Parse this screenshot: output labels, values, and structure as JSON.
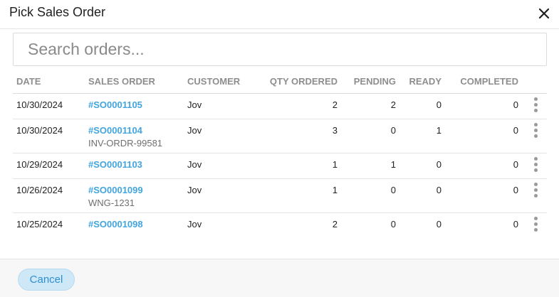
{
  "dialog": {
    "title": "Pick Sales Order"
  },
  "search": {
    "placeholder": "Search orders...",
    "value": ""
  },
  "table": {
    "columns": [
      "DATE",
      "SALES ORDER",
      "CUSTOMER",
      "QTY ORDERED",
      "PENDING",
      "READY",
      "COMPLETED"
    ],
    "rows": [
      {
        "date": "10/30/2024",
        "order": "#SO0001105",
        "ref": "",
        "customer": "Jov",
        "qty_ordered": "2",
        "pending": "2",
        "ready": "0",
        "completed": "0"
      },
      {
        "date": "10/30/2024",
        "order": "#SO0001104",
        "ref": "INV-ORDR-99581",
        "customer": "Jov",
        "qty_ordered": "3",
        "pending": "0",
        "ready": "1",
        "completed": "0"
      },
      {
        "date": "10/29/2024",
        "order": "#SO0001103",
        "ref": "",
        "customer": "Jov",
        "qty_ordered": "1",
        "pending": "1",
        "ready": "0",
        "completed": "0"
      },
      {
        "date": "10/26/2024",
        "order": "#SO0001099",
        "ref": "WNG-1231",
        "customer": "Jov",
        "qty_ordered": "1",
        "pending": "0",
        "ready": "0",
        "completed": "0"
      },
      {
        "date": "10/25/2024",
        "order": "#SO0001098",
        "ref": "",
        "customer": "Jov",
        "qty_ordered": "2",
        "pending": "0",
        "ready": "0",
        "completed": "0"
      }
    ]
  },
  "footer": {
    "cancel_label": "Cancel"
  },
  "icons": {
    "close": "close-icon",
    "row_menu": "more-vertical-icon"
  },
  "colors": {
    "link": "#42a5e0",
    "cancel_bg": "#cfe8f8",
    "cancel_text": "#2e8fd0",
    "header_text": "#8e8e8e"
  }
}
